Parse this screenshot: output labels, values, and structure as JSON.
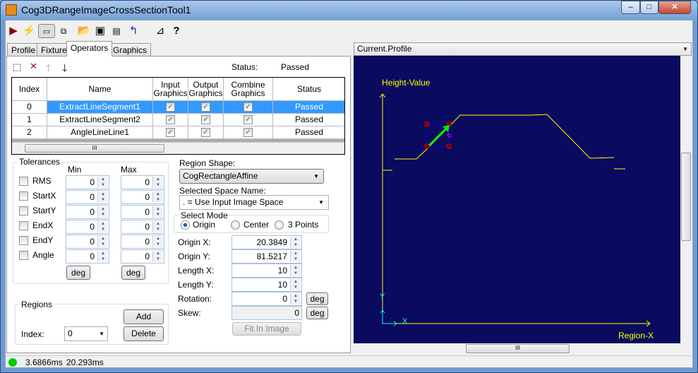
{
  "window": {
    "title": "Cog3DRangeImageCrossSectionTool1"
  },
  "toolbar": {
    "icons": [
      "run-icon",
      "electric-icon",
      "show-image-icon",
      "floating-icon",
      "open-icon",
      "save-icon",
      "save-as-icon",
      "reset-icon",
      "tool-icon",
      "help-icon"
    ]
  },
  "tabs": [
    "Profile",
    "Fixture",
    "Operators",
    "Graphics"
  ],
  "active_tab": "Operators",
  "operators": {
    "status_label": "Status:",
    "status_value": "Passed",
    "columns": [
      "Index",
      "Name",
      "Input Graphics",
      "Output Graphics",
      "Combine Graphics",
      "Status"
    ],
    "rows": [
      {
        "index": "0",
        "name": "ExtractLineSegment1",
        "input": true,
        "output": true,
        "combine": true,
        "status": "Passed",
        "selected": true
      },
      {
        "index": "1",
        "name": "ExtractLineSegment2",
        "input": true,
        "output": true,
        "combine": true,
        "status": "Passed",
        "selected": false
      },
      {
        "index": "2",
        "name": "AngleLineLine1",
        "input": true,
        "output": true,
        "combine": true,
        "status": "Passed",
        "selected": false
      }
    ]
  },
  "tolerances": {
    "title": "Tolerances",
    "min_label": "Min",
    "max_label": "Max",
    "deg": "deg",
    "rows": [
      {
        "label": "RMS",
        "min": "0",
        "max": "0"
      },
      {
        "label": "StartX",
        "min": "0",
        "max": "0"
      },
      {
        "label": "StartY",
        "min": "0",
        "max": "0"
      },
      {
        "label": "EndX",
        "min": "0",
        "max": "0"
      },
      {
        "label": "EndY",
        "min": "0",
        "max": "0"
      },
      {
        "label": "Angle",
        "min": "0",
        "max": "0"
      }
    ]
  },
  "regions": {
    "title": "Regions",
    "add": "Add",
    "delete": "Delete",
    "index_label": "Index:",
    "index_value": "0"
  },
  "region": {
    "shape_label": "Region Shape:",
    "shape_value": "CogRectangleAffine",
    "space_label": "Selected Space Name:",
    "space_value": ". = Use Input Image Space",
    "mode_title": "Select Mode",
    "modes": [
      "Origin",
      "Center",
      "3 Points"
    ],
    "selected_mode": "Origin",
    "fields": [
      {
        "label": "Origin X:",
        "value": "20.3849"
      },
      {
        "label": "Origin Y:",
        "value": "81.5217"
      },
      {
        "label": "Length X:",
        "value": "10"
      },
      {
        "label": "Length Y:",
        "value": "10"
      },
      {
        "label": "Rotation:",
        "value": "0"
      },
      {
        "label": "Skew:",
        "value": "0"
      }
    ],
    "deg": "deg",
    "fit": "Fit In Image"
  },
  "display": {
    "selector": "Current.Profile",
    "y_axis_label": "Height-Value",
    "x_axis_label": "Region-X",
    "coord_x": "X",
    "coord_y": "Y",
    "background": "#0a0a5e",
    "profile_color": "#ffff00"
  },
  "statusbar": {
    "time1": "3.6866ms",
    "time2": "20.293ms",
    "indicator_color": "#00cc00"
  }
}
